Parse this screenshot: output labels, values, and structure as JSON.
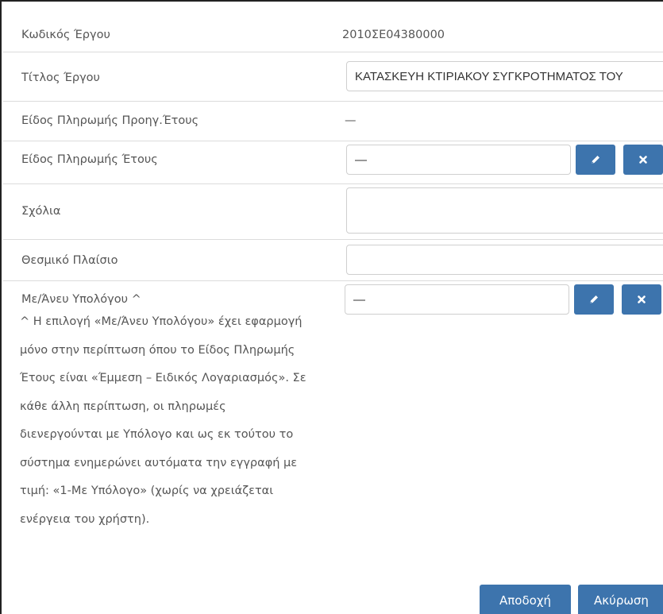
{
  "fields": {
    "project_code": {
      "label": "Κωδικός Έργου",
      "value": "2010ΣΕ04380000"
    },
    "project_title": {
      "label": "Τίτλος Έργου",
      "value": "ΚΑΤΑΣΚΕΥΗ ΚΤΙΡΙΑΚΟΥ ΣΥΓΚΡΟΤΗΜΑΤΟΣ ΤΟΥ"
    },
    "prev_payment_type": {
      "label": "Είδος Πληρωμής Προηγ.Έτους",
      "value": "—"
    },
    "payment_type": {
      "label": "Είδος Πληρωμής Έτους",
      "value": "—"
    },
    "comments": {
      "label": "Σχόλια",
      "value": ""
    },
    "legal_framework": {
      "label": "Θεσμικό Πλαίσιο",
      "value": ""
    },
    "accountant": {
      "label": "Με/Άνευ Υπολόγου ^",
      "value": "—"
    }
  },
  "note_lines": [
    "^ Η επιλογή «Με/Άνευ Υπολόγου» έχει εφαρμογή",
    "μόνο στην περίπτωση όπου το Είδος Πληρωμής",
    "Έτους είναι «Έμμεση – Ειδικός Λογαριασμός». Σε",
    "κάθε άλλη περίπτωση, οι πληρωμές",
    "διενεργούνται με Υπόλογο και ως εκ τούτου το",
    "σύστημα ενημερώνει αυτόματα την εγγραφή με",
    "τιμή: «1-Με Υπόλογο» (χωρίς να χρειάζεται",
    "ενέργεια του χρήστη)."
  ],
  "footer": {
    "accept_label": "Αποδοχή",
    "cancel_label": "Ακύρωση"
  },
  "icons": {
    "edit": "pencil-icon",
    "clear": "close-icon",
    "resize": "resize-grip-icon"
  },
  "colors": {
    "button": "#3d74ad",
    "divider": "#dcdcdc",
    "text": "#555555"
  }
}
